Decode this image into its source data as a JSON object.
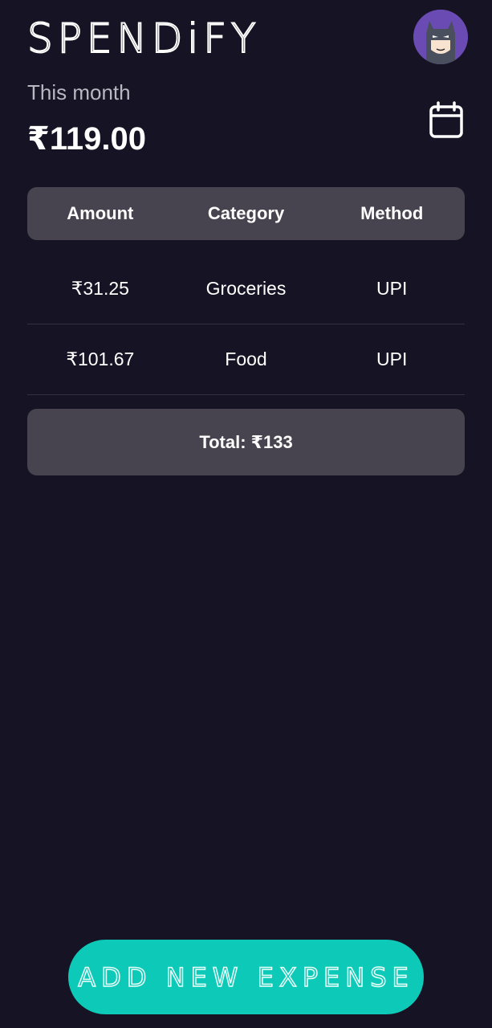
{
  "header": {
    "app_title": "SPENDiFY",
    "avatar_icon": "batman-avatar-icon",
    "calendar_icon": "calendar-icon"
  },
  "summary": {
    "period_label": "This month",
    "amount": "₹119.00"
  },
  "table": {
    "columns": [
      "Amount",
      "Category",
      "Method"
    ],
    "rows": [
      {
        "amount": "₹31.25",
        "category": "Groceries",
        "method": "UPI"
      },
      {
        "amount": "₹101.67",
        "category": "Food",
        "method": "UPI"
      }
    ],
    "total": "Total: ₹133"
  },
  "actions": {
    "add_label": "ADD NEW EXPENSE"
  },
  "colors": {
    "background": "#161324",
    "card": "#47444f",
    "accent": "#0dc9b7",
    "avatar_bg": "#6a4bb4"
  }
}
